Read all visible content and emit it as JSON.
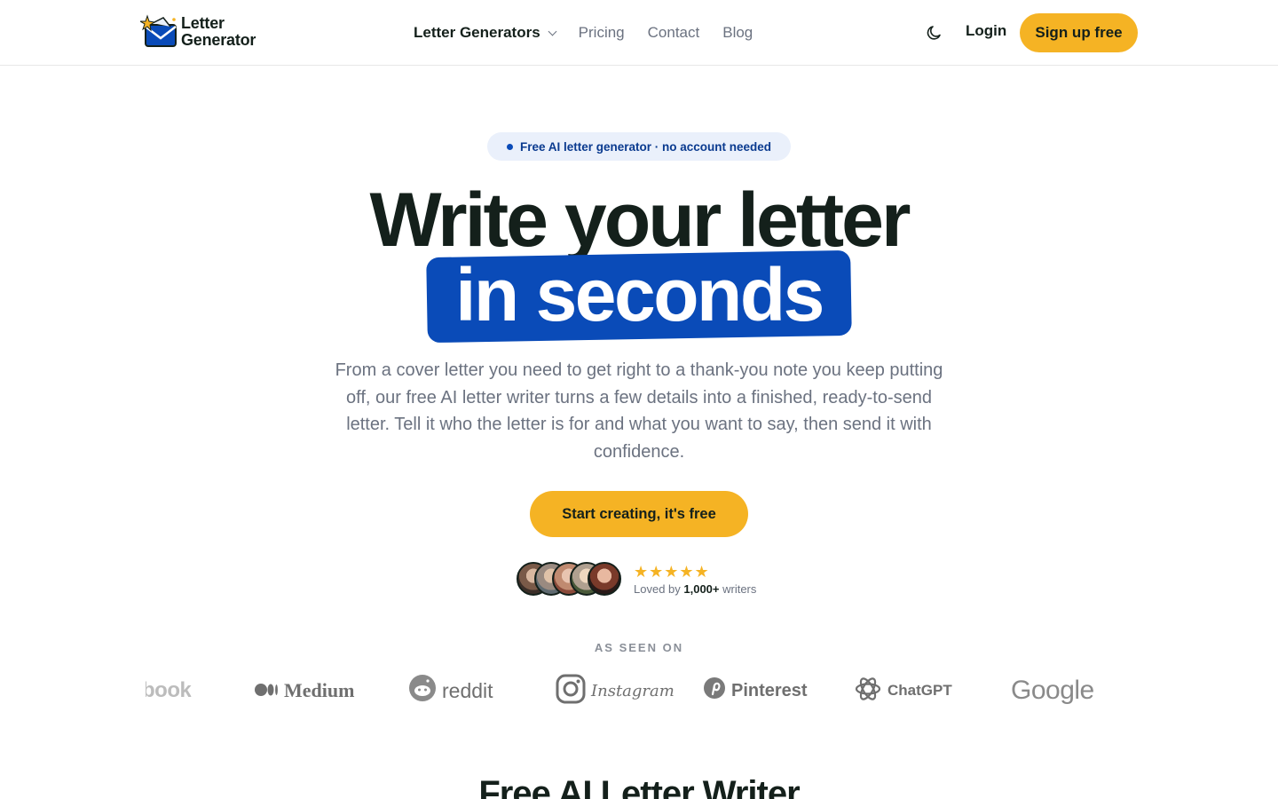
{
  "header": {
    "logo_line1": "Letter",
    "logo_line2": "Generator",
    "nav": [
      {
        "label": "Letter Generators"
      },
      {
        "label": "Pricing"
      },
      {
        "label": "Contact"
      },
      {
        "label": "Blog"
      }
    ],
    "login_label": "Login",
    "signup_label": "Sign up free"
  },
  "hero": {
    "badge": "Free AI letter generator · no account needed",
    "headline_line1": "Write your letter",
    "headline_highlight": "in seconds",
    "subtext": "From a cover letter you need to get right to a thank-you note you keep putting off, our free AI letter writer turns a few details into a finished, ready-to-send letter. Tell it who the letter is for and what you want to say, then send it with confidence.",
    "cta_label": "Start creating, it's free",
    "stars": "★★★★★",
    "loved_prefix": "Loved by ",
    "loved_count": "1,000+",
    "loved_suffix": " writers"
  },
  "seen_on": {
    "label": "AS SEEN ON",
    "brands": [
      "book",
      "Medium",
      "reddit",
      "Instagram",
      "Pinterest",
      "ChatGPT",
      "Google"
    ]
  },
  "section": {
    "title": "Free AI Letter Writer"
  },
  "colors": {
    "accent_yellow": "#f5b324",
    "brand_blue": "#0a4bb8",
    "text_dark": "#14201b",
    "text_muted": "#6b7280"
  }
}
